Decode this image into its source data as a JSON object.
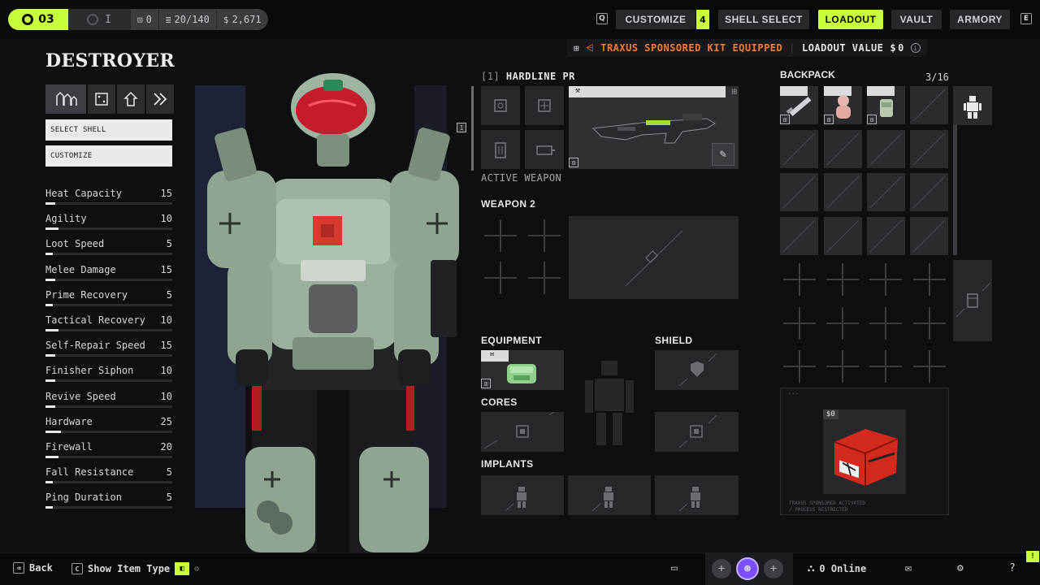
{
  "topbar": {
    "level": "03",
    "rank": "I",
    "stat_a": "0",
    "stat_b": "20/140",
    "credits": "2,671",
    "customize_label": "CUSTOMIZE",
    "customize_badge": "4",
    "shell_select_label": "SHELL SELECT",
    "loadout_label": "LOADOUT",
    "vault_label": "VAULT",
    "armory_label": "ARMORY",
    "key_left": "Q",
    "key_right": "E",
    "accent": "#c8ff3c"
  },
  "sponsor": {
    "text": "TRAXUS SPONSORED KIT EQUIPPED",
    "value_label": "LOADOUT VALUE",
    "value": "0",
    "orange": "#ff7a2a"
  },
  "shell": {
    "title": "DESTROYER",
    "select_shell_label": "SELECT SHELL",
    "customize_label": "CUSTOMIZE",
    "stats": [
      {
        "name": "Heat Capacity",
        "value": "15",
        "fill": 0.08
      },
      {
        "name": "Agility",
        "value": "10",
        "fill": 0.1
      },
      {
        "name": "Loot Speed",
        "value": "5",
        "fill": 0.06
      },
      {
        "name": "Melee Damage",
        "value": "15",
        "fill": 0.08
      },
      {
        "name": "Prime Recovery",
        "value": "5",
        "fill": 0.06
      },
      {
        "name": "Tactical Recovery",
        "value": "10",
        "fill": 0.1
      },
      {
        "name": "Self-Repair Speed",
        "value": "15",
        "fill": 0.08
      },
      {
        "name": "Finisher Siphon",
        "value": "10",
        "fill": 0.08
      },
      {
        "name": "Revive Speed",
        "value": "10",
        "fill": 0.08
      },
      {
        "name": "Hardware",
        "value": "25",
        "fill": 0.12
      },
      {
        "name": "Firewall",
        "value": "20",
        "fill": 0.1
      },
      {
        "name": "Fall Resistance",
        "value": "5",
        "fill": 0.06
      },
      {
        "name": "Ping Duration",
        "value": "5",
        "fill": 0.06
      }
    ]
  },
  "weapons": {
    "slot_index": "[1]",
    "weapon_name": "HARDLINE PR",
    "active_label": "ACTIVE WEAPON",
    "weapon2_label": "WEAPON 2",
    "side_key": "1"
  },
  "gear": {
    "equipment_label": "EQUIPMENT",
    "shield_label": "SHIELD",
    "cores_label": "CORES",
    "implants_label": "IMPLANTS"
  },
  "backpack": {
    "title": "BACKPACK",
    "count": "3/16",
    "kit_price": "0",
    "kit_caption_1": "TRAXUS SPONSORED ACTIVATED",
    "kit_caption_2": "/ PROCESS RESTRICTED"
  },
  "bottombar": {
    "back_label": "Back",
    "show_item_type_label": "Show Item Type",
    "online_label": "0 Online"
  }
}
